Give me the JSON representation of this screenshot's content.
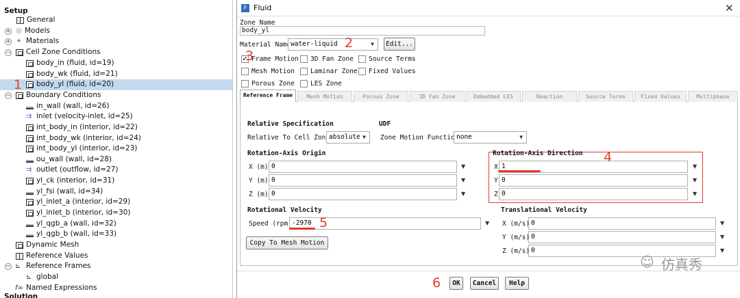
{
  "tree": {
    "setup_header": "Setup",
    "solution_footer": "Solution",
    "items": [
      {
        "label": "General"
      },
      {
        "label": "Models"
      },
      {
        "label": "Materials"
      },
      {
        "label": "Cell Zone Conditions"
      },
      {
        "label": "body_in (fluid, id=19)"
      },
      {
        "label": "body_wk (fluid, id=21)"
      },
      {
        "label": "body_yl (fluid, id=20)"
      },
      {
        "label": "Boundary Conditions"
      },
      {
        "label": "in_wall (wall, id=26)"
      },
      {
        "label": "inlet (velocity-inlet, id=25)"
      },
      {
        "label": "int_body_in (interior, id=22)"
      },
      {
        "label": "int_body_wk (interior, id=24)"
      },
      {
        "label": "int_body_yl (interior, id=23)"
      },
      {
        "label": "ou_wall (wall, id=28)"
      },
      {
        "label": "outlet (outflow, id=27)"
      },
      {
        "label": "yl_ck (interior, id=31)"
      },
      {
        "label": "yl_fsi (wall, id=34)"
      },
      {
        "label": "yl_inlet_a (interior, id=29)"
      },
      {
        "label": "yl_inlet_b (interior, id=30)"
      },
      {
        "label": "yl_qgb_a (wall, id=32)"
      },
      {
        "label": "yl_qgb_b (wall, id=33)"
      },
      {
        "label": "Dynamic Mesh"
      },
      {
        "label": "Reference Values"
      },
      {
        "label": "Reference Frames"
      },
      {
        "label": "global"
      },
      {
        "label": "Named Expressions"
      }
    ]
  },
  "annotations": {
    "n1": "1",
    "n2": "2",
    "n3": "3",
    "n4": "4",
    "n5": "5",
    "n6": "6"
  },
  "dialog": {
    "title": "Fluid",
    "close": "✕",
    "zone_name_label": "Zone Name",
    "zone_name_value": "body_yl",
    "material_label": "Material Name",
    "material_value": "water-liquid",
    "edit_button": "Edit...",
    "checkboxes": {
      "frame_motion": "Frame Motion",
      "fan_zone": "3D Fan Zone",
      "source_terms": "Source Terms",
      "mesh_motion": "Mesh Motion",
      "laminar_zone": "Laminar Zone",
      "fixed_values": "Fixed Values",
      "porous_zone": "Porous Zone",
      "les_zone": "LES Zone"
    },
    "frame_motion_checked": true,
    "tabs": [
      "Reference Frame",
      "Mesh Motion",
      "Porous Zone",
      "3D Fan Zone",
      "Embedded LES",
      "Reaction",
      "Source Terms",
      "Fixed Values",
      "Multiphase"
    ],
    "relative_spec": {
      "title": "Relative Specification",
      "label": "Relative To Cell Zone",
      "value": "absolute"
    },
    "udf": {
      "title": "UDF",
      "label": "Zone Motion Function",
      "value": "none"
    },
    "axis_origin": {
      "title": "Rotation-Axis Origin",
      "x_label": "X (m)",
      "x_value": "0",
      "y_label": "Y (m)",
      "y_value": "0",
      "z_label": "Z (m)",
      "z_value": "0"
    },
    "axis_direction": {
      "title": "Rotation-Axis Direction",
      "x_label": "X",
      "x_value": "1",
      "y_label": "Y",
      "y_value": "0",
      "z_label": "Z",
      "z_value": "0"
    },
    "rot_velocity": {
      "title": "Rotational Velocity",
      "label": "Speed (rpm)",
      "value": "-2970"
    },
    "trans_velocity": {
      "title": "Translational Velocity",
      "x_label": "X (m/s)",
      "x_value": "0",
      "y_label": "Y (m/s)",
      "y_value": "0",
      "z_label": "Z (m/s)",
      "z_value": "0"
    },
    "copy_button": "Copy To Mesh Motion",
    "ok_button": "OK",
    "cancel_button": "Cancel",
    "help_button": "Help"
  },
  "watermark": "仿真秀",
  "colors": {
    "annotation": "#e23b2d",
    "selection": "#c3d9ee",
    "title_icon": "#2d6fb8"
  }
}
